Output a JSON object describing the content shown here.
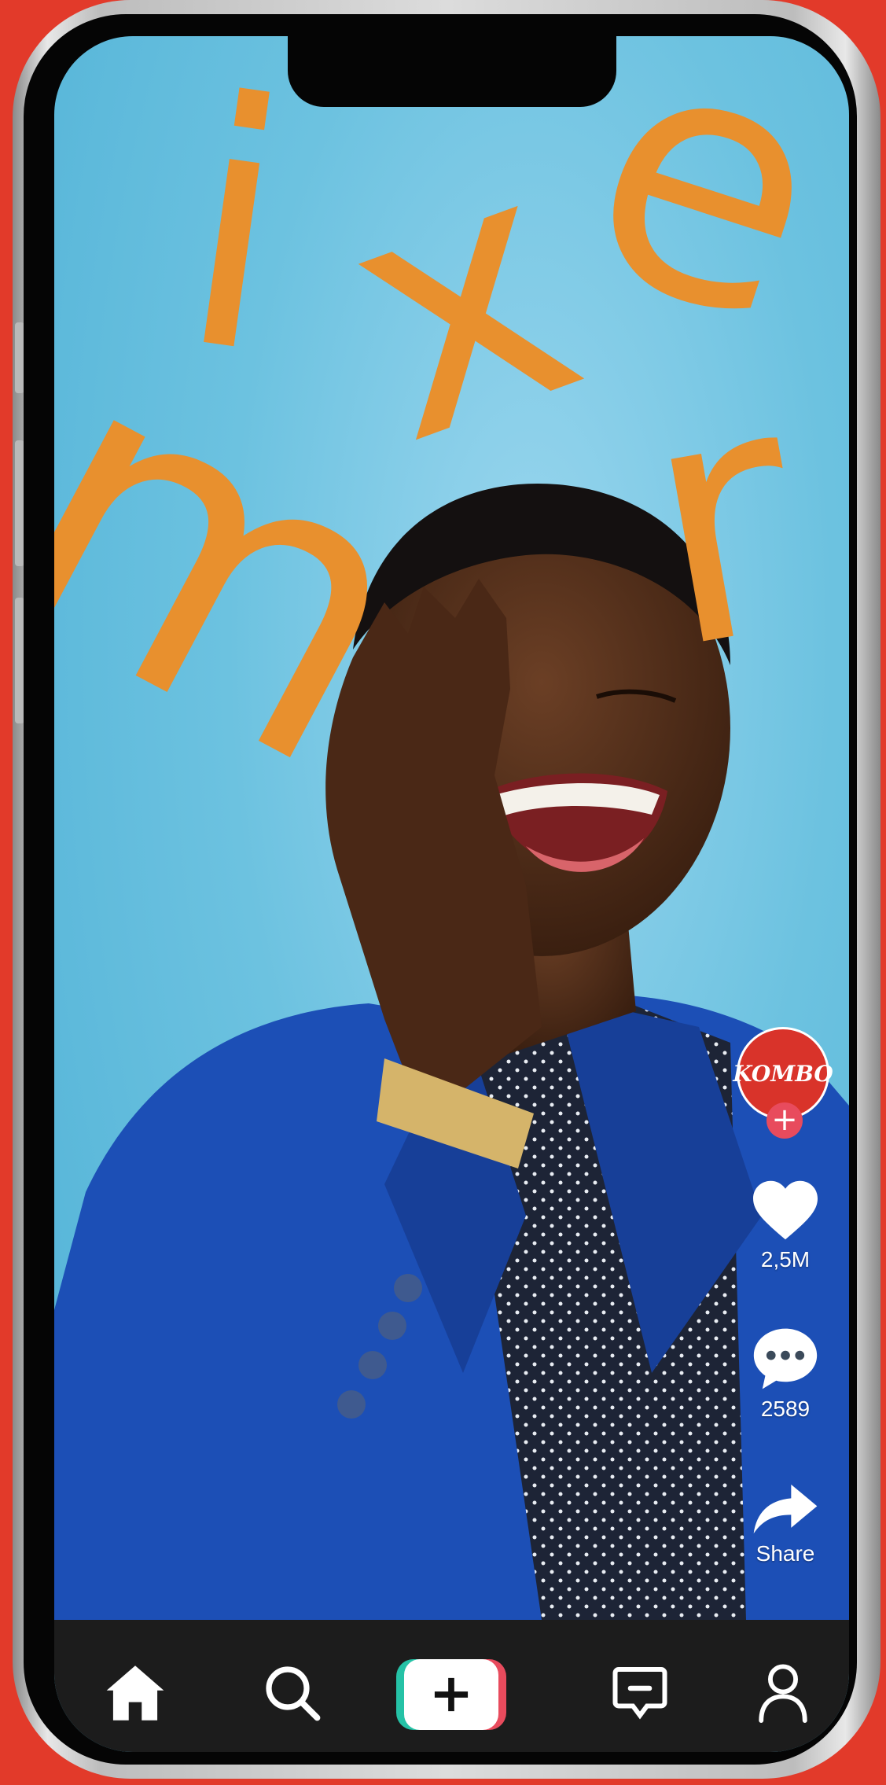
{
  "colors": {
    "background": "#e23a2a",
    "sky": "#6cc2e0",
    "letters": "#e8902e",
    "accent_pink": "#e84b5d",
    "accent_teal": "#25c2a6",
    "navbar": "#1c1c1c"
  },
  "overlay_letters": [
    "m",
    "i",
    "x",
    "e",
    "r"
  ],
  "creator": {
    "brand_text": "KOMBO",
    "follow_icon": "plus-icon"
  },
  "actions": {
    "likes": {
      "icon": "heart-icon",
      "count": "2,5M"
    },
    "comments": {
      "icon": "comment-icon",
      "count": "2589"
    },
    "share": {
      "icon": "share-icon",
      "label": "Share"
    }
  },
  "nav": [
    {
      "id": "home",
      "icon": "home-icon"
    },
    {
      "id": "search",
      "icon": "search-icon"
    },
    {
      "id": "create",
      "icon": "plus-icon"
    },
    {
      "id": "inbox",
      "icon": "inbox-icon"
    },
    {
      "id": "profile",
      "icon": "profile-icon"
    }
  ]
}
